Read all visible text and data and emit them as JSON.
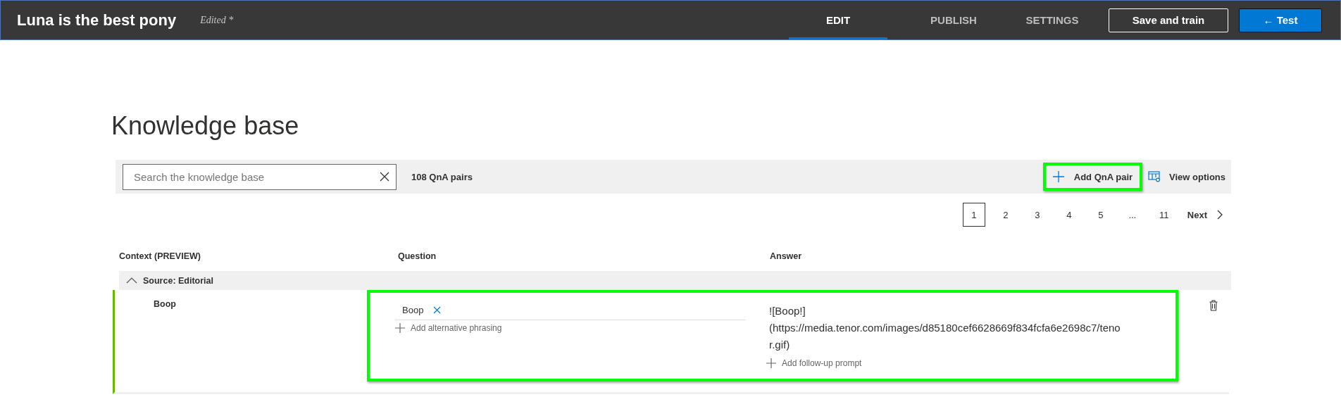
{
  "header": {
    "title": "Luna is the best pony",
    "status": "Edited *",
    "tabs": [
      {
        "label": "EDIT",
        "selected": true
      },
      {
        "label": "PUBLISH",
        "selected": false
      },
      {
        "label": "SETTINGS",
        "selected": false
      }
    ],
    "buttons": [
      {
        "label": "Save and train",
        "kind": "secondary"
      },
      {
        "label": "← Test",
        "kind": "primary"
      }
    ]
  },
  "page_title": "Knowledge base",
  "toolbar": {
    "search": {
      "placeholder": "Search the knowledge base"
    },
    "count": "108 QnA pairs",
    "actions": [
      {
        "label": "Add QnA pair",
        "kind": "add",
        "highlighted": true
      },
      {
        "label": "View options",
        "kind": "view",
        "highlighted": false
      }
    ]
  },
  "pagination": {
    "pages": [
      {
        "label": "1",
        "selected": true
      },
      {
        "label": "2",
        "selected": false
      },
      {
        "label": "3",
        "selected": false
      },
      {
        "label": "4",
        "selected": false
      },
      {
        "label": "5",
        "selected": false
      },
      {
        "label": "...",
        "selected": false
      },
      {
        "label": "11",
        "selected": false
      }
    ],
    "next": "Next"
  },
  "table": {
    "columns": [
      "Context (PREVIEW)",
      "Question",
      "Answer"
    ],
    "groups": [
      {
        "label": "Source: Editorial",
        "expanded": true,
        "rows": [
          {
            "context": "Boop",
            "highlighted": true,
            "questions": [
              "Boop"
            ],
            "add_phrasing": "Add alternative phrasing",
            "answer": "![Boop!](https://media.tenor.com/images/d85180cef6628669f834fcfa6e2698c7/tenor.gif)",
            "add_prompt": "Add follow-up prompt"
          }
        ]
      }
    ]
  }
}
